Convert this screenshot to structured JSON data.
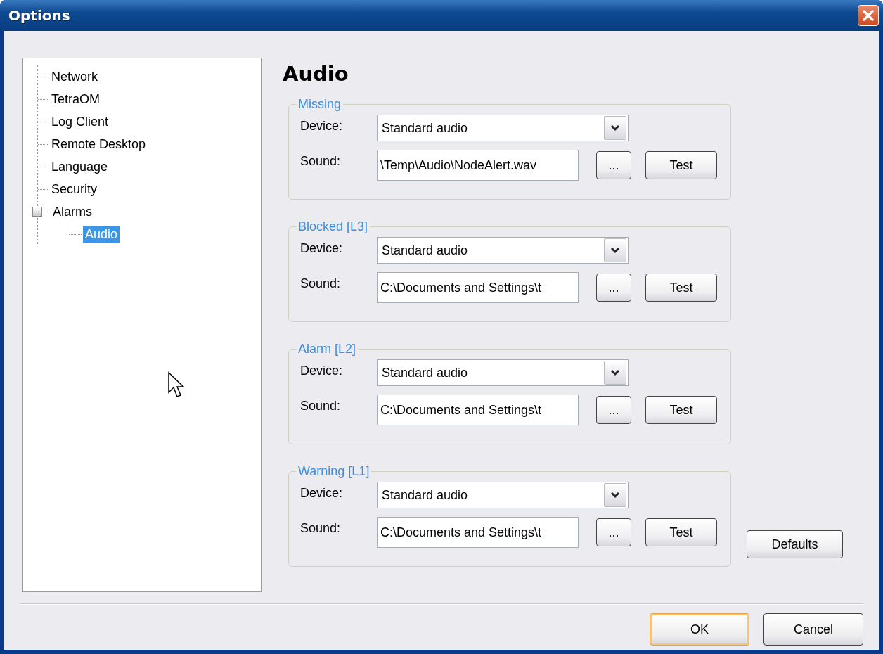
{
  "window": {
    "title": "Options"
  },
  "tree": [
    {
      "label": "Network",
      "selected": false
    },
    {
      "label": "TetraOM",
      "selected": false
    },
    {
      "label": "Log Client",
      "selected": false
    },
    {
      "label": "Remote Desktop",
      "selected": false
    },
    {
      "label": "Language",
      "selected": false
    },
    {
      "label": "Security",
      "selected": false
    },
    {
      "label": "Alarms",
      "selected": false,
      "expanded": true,
      "children": [
        {
          "label": "Audio",
          "selected": true
        }
      ]
    }
  ],
  "page_title": "Audio",
  "groups": [
    {
      "title": "Missing",
      "device_label": "Device:",
      "device": "Standard audio",
      "sound_label": "Sound:",
      "sound": "\\Temp\\Audio\\NodeAlert.wav",
      "browse": "...",
      "test": "Test"
    },
    {
      "title": "Blocked [L3]",
      "device_label": "Device:",
      "device": "Standard audio",
      "sound_label": "Sound:",
      "sound": "C:\\Documents and Settings\\t",
      "browse": "...",
      "test": "Test"
    },
    {
      "title": "Alarm [L2]",
      "device_label": "Device:",
      "device": "Standard audio",
      "sound_label": "Sound:",
      "sound": "C:\\Documents and Settings\\t",
      "browse": "...",
      "test": "Test"
    },
    {
      "title": "Warning [L1]",
      "device_label": "Device:",
      "device": "Standard audio",
      "sound_label": "Sound:",
      "sound": "C:\\Documents and Settings\\t",
      "browse": "...",
      "test": "Test"
    }
  ],
  "defaults_button": "Defaults",
  "buttons": [
    {
      "label": "OK",
      "default": true
    },
    {
      "label": "Cancel",
      "default": false
    }
  ]
}
